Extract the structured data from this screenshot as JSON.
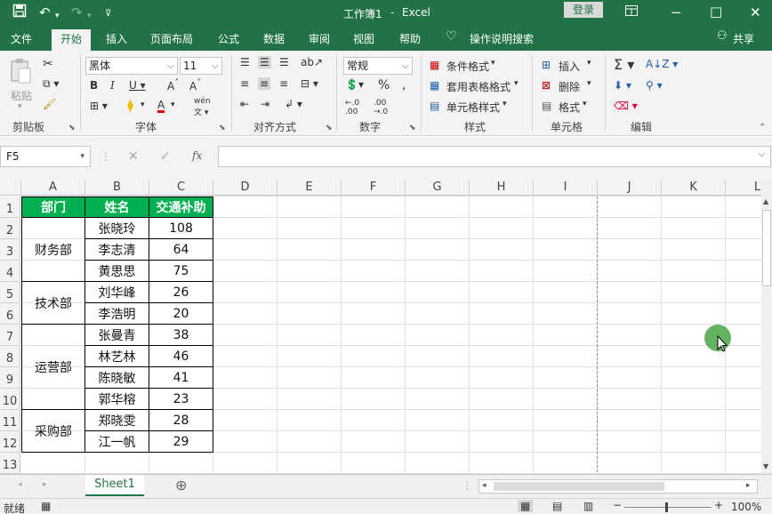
{
  "title": {
    "workbook": "工作簿1",
    "separator": "-",
    "app": "Excel",
    "login": "登录"
  },
  "tabs": [
    "文件",
    "开始",
    "插入",
    "页面布局",
    "公式",
    "数据",
    "审阅",
    "视图",
    "帮助"
  ],
  "tell_me": "操作说明搜索",
  "share": "共享",
  "ribbon": {
    "paste": "粘贴",
    "font_name": "黑体",
    "font_size": "11",
    "number_format": "常规",
    "conditional": "条件格式",
    "table_format": "套用表格格式",
    "cell_style": "单元格样式",
    "insert": "插入",
    "delete": "删除",
    "format": "格式",
    "groups": [
      "剪贴板",
      "字体",
      "对齐方式",
      "数字",
      "样式",
      "单元格",
      "编辑"
    ]
  },
  "namebox": "F5",
  "fx": "fx",
  "columns": [
    "A",
    "B",
    "C",
    "D",
    "E",
    "F",
    "G",
    "H",
    "I",
    "J",
    "K",
    "L"
  ],
  "rows": [
    "1",
    "2",
    "3",
    "4",
    "5",
    "6",
    "7",
    "8",
    "9",
    "10",
    "11",
    "12",
    "13"
  ],
  "table": {
    "headers": [
      "部门",
      "姓名",
      "交通补助"
    ],
    "departments": [
      "财务部",
      "技术部",
      "运营部",
      "采购部"
    ],
    "names": [
      "张晓玲",
      "李志清",
      "黄思思",
      "刘华峰",
      "李浩明",
      "张曼青",
      "林艺林",
      "陈晓敏",
      "郭华榕",
      "郑晓雯",
      "江一帆"
    ],
    "values": [
      "108",
      "64",
      "75",
      "26",
      "20",
      "38",
      "46",
      "41",
      "23",
      "28",
      "29"
    ]
  },
  "sheet": "Sheet1",
  "status": {
    "ready": "就绪",
    "zoom": "100%"
  }
}
